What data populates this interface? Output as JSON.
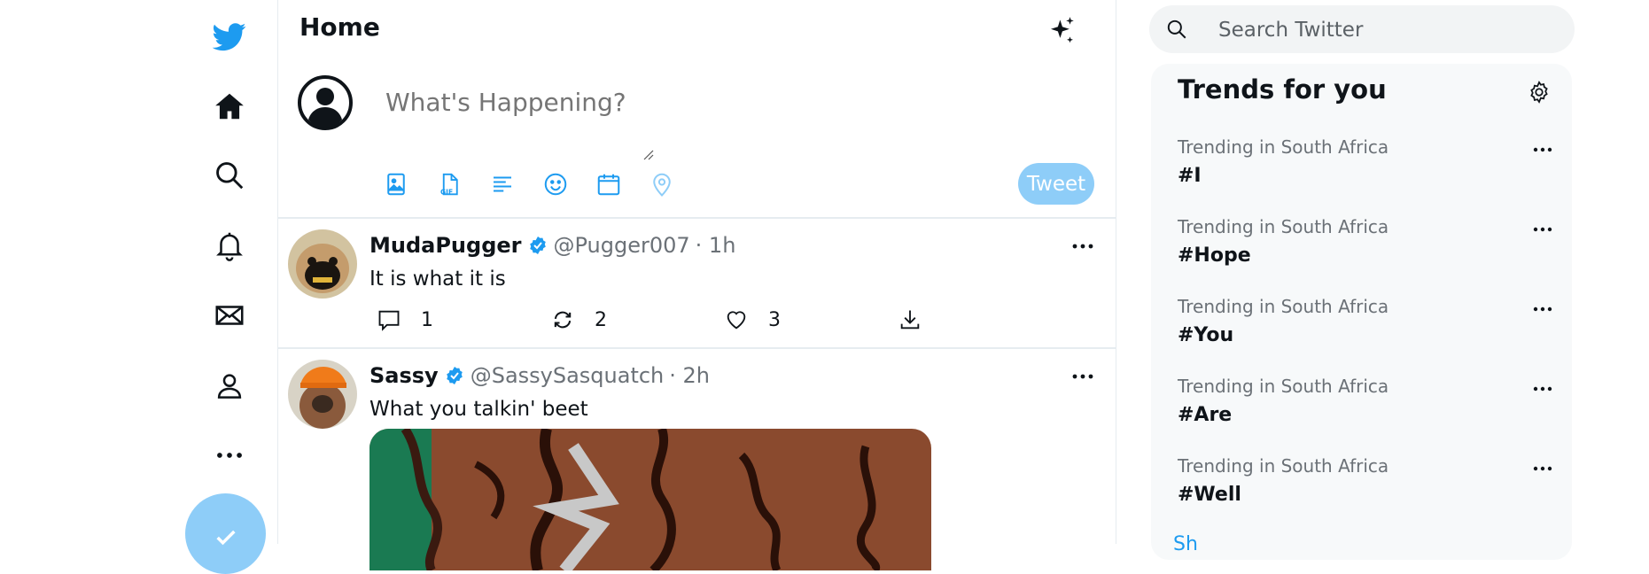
{
  "nav": {
    "items": [
      "twitter-logo",
      "home",
      "explore",
      "notifications",
      "messages",
      "profile",
      "more"
    ],
    "fab_icon": "check"
  },
  "main": {
    "title": "Home",
    "composer": {
      "placeholder": "What's Happening?",
      "tweet_button": "Tweet",
      "tools": [
        "image-icon",
        "gif-icon",
        "poll-icon",
        "emoji-icon",
        "schedule-icon",
        "location-icon"
      ]
    },
    "tweets": [
      {
        "name": "MudaPugger",
        "handle": "@Pugger007",
        "time": "· 1h",
        "text": "It is what it is",
        "replies": "1",
        "retweets": "2",
        "likes": "3"
      },
      {
        "name": "Sassy",
        "handle": "@SassySasquatch",
        "time": "· 2h",
        "text": "What you talkin' beet"
      }
    ]
  },
  "right": {
    "search_placeholder": "Search Twitter",
    "trends_title": "Trends for you",
    "trends": [
      {
        "meta": "Trending in South Africa",
        "tag": "#I"
      },
      {
        "meta": "Trending in South Africa",
        "tag": "#Hope"
      },
      {
        "meta": "Trending in South Africa",
        "tag": "#You"
      },
      {
        "meta": "Trending in South Africa",
        "tag": "#Are"
      },
      {
        "meta": "Trending in South Africa",
        "tag": "#Well"
      }
    ],
    "show_more": "Sh"
  },
  "colors": {
    "accent": "#1d9bf0",
    "accent_light": "#8ecdf8",
    "border": "#e6ecf0",
    "muted": "#6b7177"
  }
}
